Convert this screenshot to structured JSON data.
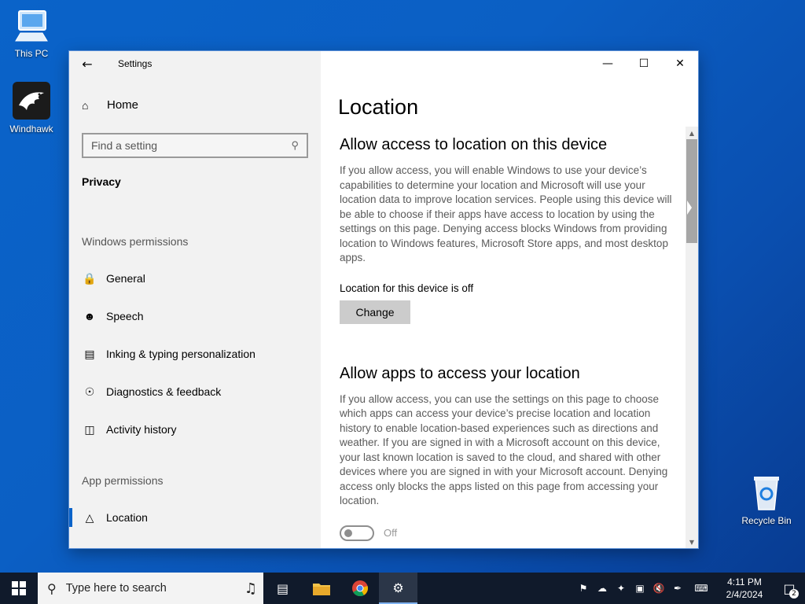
{
  "desktop": {
    "icons": [
      {
        "label": "This PC",
        "icon": "computer-icon"
      },
      {
        "label": "Windhawk",
        "icon": "eagle-icon"
      },
      {
        "label": "Recycle Bin",
        "icon": "recycle-bin-icon"
      }
    ]
  },
  "window": {
    "title": "Settings",
    "sidebar": {
      "home": "Home",
      "search_placeholder": "Find a setting",
      "section": "Privacy",
      "windows_permissions_header": "Windows permissions",
      "windows_permissions": [
        {
          "label": "General",
          "icon": "lock-icon"
        },
        {
          "label": "Speech",
          "icon": "speech-icon"
        },
        {
          "label": "Inking & typing personalization",
          "icon": "clipboard-icon"
        },
        {
          "label": "Diagnostics & feedback",
          "icon": "feedback-icon"
        },
        {
          "label": "Activity history",
          "icon": "timeline-icon"
        }
      ],
      "app_permissions_header": "App permissions",
      "app_permissions": [
        {
          "label": "Location",
          "icon": "location-icon",
          "selected": true
        }
      ]
    },
    "main": {
      "page_title": "Location",
      "section1_heading": "Allow access to location on this device",
      "section1_desc": "If you allow access, you will enable Windows to use your device’s capabilities to determine your location and Microsoft will use your location data to improve location services. People using this device will be able to choose if their apps have access to location by using the settings on this page. Denying access blocks Windows from providing location to Windows features, Microsoft Store apps, and most desktop apps.",
      "device_status": "Location for this device is off",
      "change_label": "Change",
      "section2_heading": "Allow apps to access your location",
      "section2_desc": "If you allow access, you can use the settings on this page to choose which apps can access your device’s precise location and location history to enable location-based experiences such as directions and weather. If you are signed in with a Microsoft account on this device, your last known location is saved to the cloud, and shared with other devices where you are signed in with your Microsoft account. Denying access only blocks the apps listed on this page from accessing your location.",
      "toggle_state": "Off"
    }
  },
  "taskbar": {
    "search_placeholder": "Type here to search",
    "time": "4:11 PM",
    "date": "2/4/2024",
    "notification_count": "2"
  },
  "colors": {
    "accent": "#0a63c9",
    "taskbar": "#101a2b",
    "sidebar_bg": "#f2f2f2"
  }
}
